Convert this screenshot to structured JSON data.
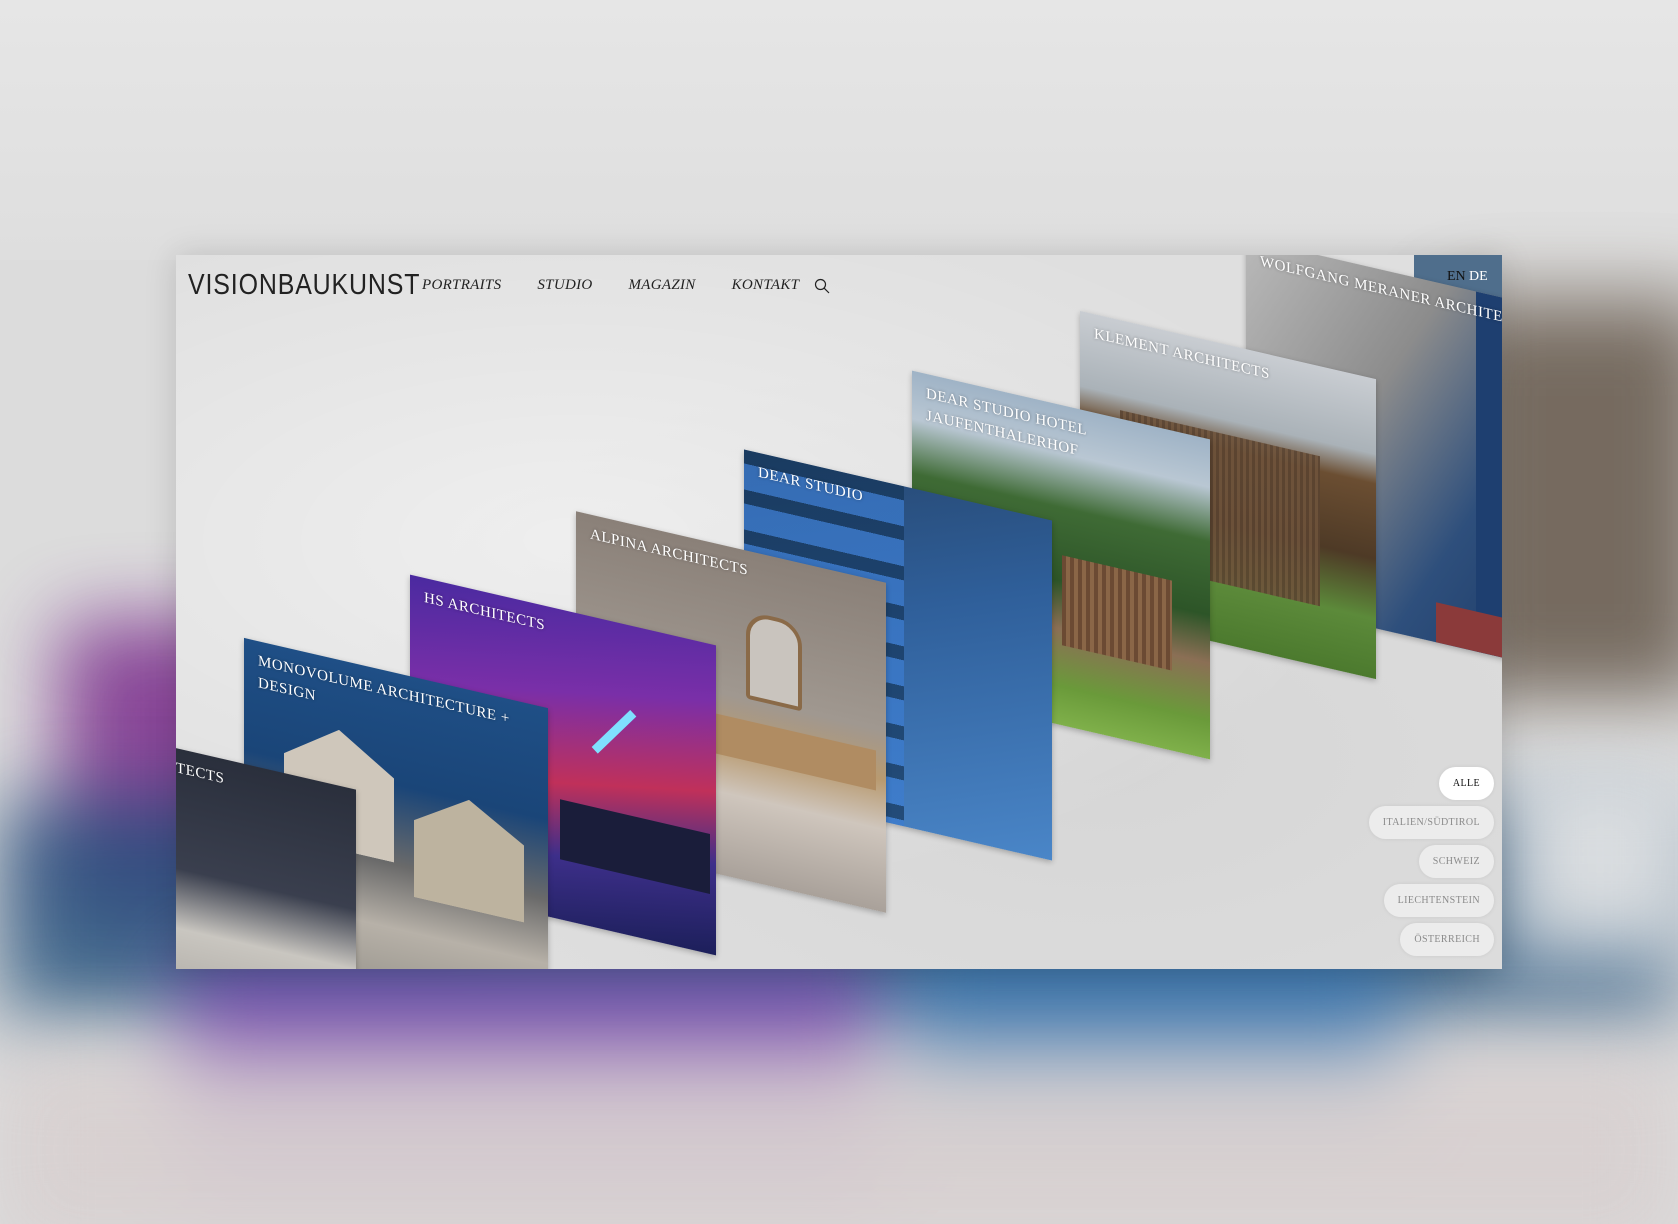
{
  "site": {
    "logo": "VISIONBAUKUNST",
    "nav": [
      "PORTRAITS",
      "STUDIO",
      "MAGAZIN",
      "KONTAKT"
    ],
    "lang": {
      "en": "EN",
      "de": "DE"
    }
  },
  "cards": [
    {
      "title": "WOLFGANG MERANER ARCHITEKT"
    },
    {
      "title": "KLEMENT ARCHITECTS"
    },
    {
      "title": "DEAR STUDIO HOTEL JAUFENTHALERHOF"
    },
    {
      "title": "DEAR STUDIO"
    },
    {
      "title": "ALPINA ARCHITECTS"
    },
    {
      "title": "HS ARCHITECTS"
    },
    {
      "title": "MONOVOLUME ARCHITECTURE + DESIGN"
    },
    {
      "title": "TECTS"
    }
  ],
  "filters": [
    "ALLE",
    "ITALIEN/SÜDTIROL",
    "SCHWEIZ",
    "LIECHTENSTEIN",
    "ÖSTERREICH"
  ]
}
